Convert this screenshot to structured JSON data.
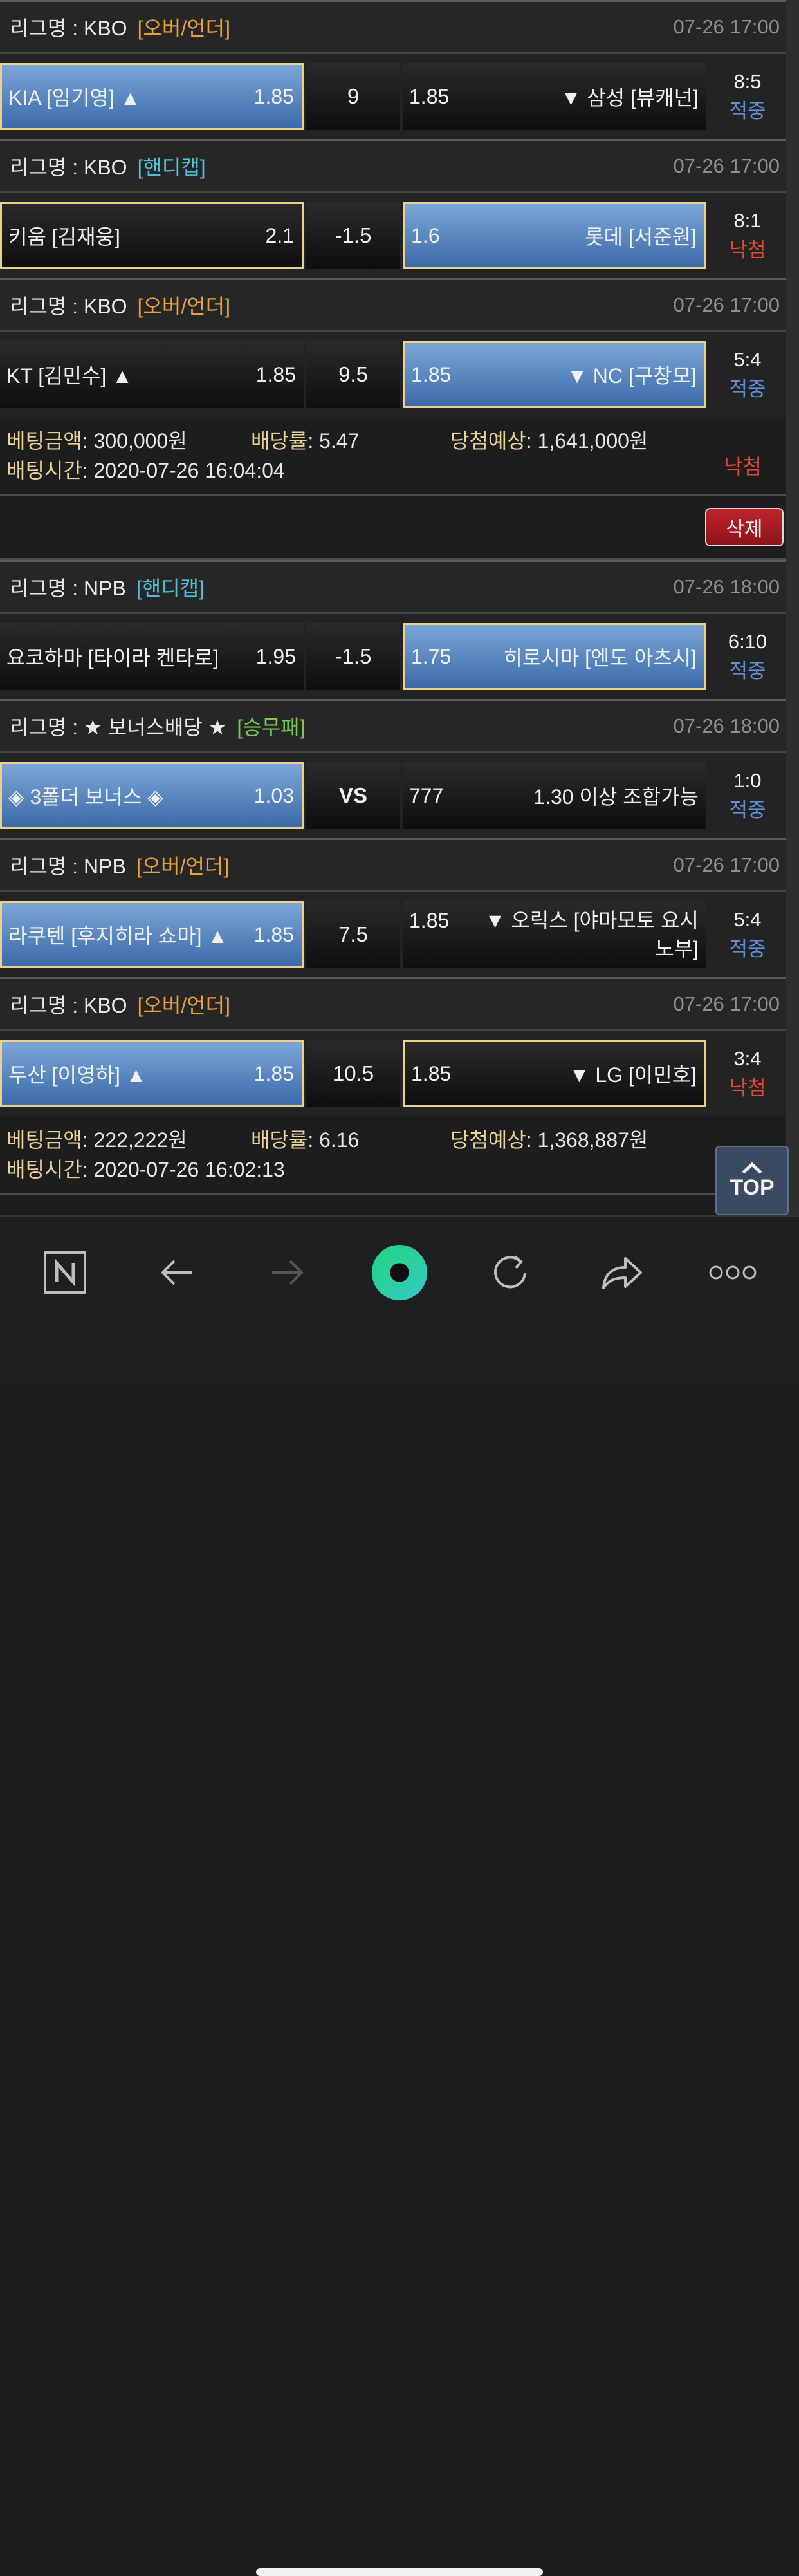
{
  "matches_block1": [
    {
      "league": "리그명 : KBO",
      "type": "[오버/언더]",
      "type_class": "t-ou",
      "time": "07-26 17:00",
      "home": "KIA [임기영] ▲",
      "home_odds": "1.85",
      "handicap": "9",
      "away_odds": "1.85",
      "away": "▼ 삼성 [뷰캐넌]",
      "score": "8:5",
      "status": "적중",
      "selected": "home"
    },
    {
      "league": "리그명 : KBO",
      "type": "[핸디캡]",
      "type_class": "t-hc",
      "time": "07-26 17:00",
      "home": "키움 [김재웅]",
      "home_odds": "2.1",
      "handicap": "-1.5",
      "away_odds": "1.6",
      "away": "롯데 [서준원]",
      "score": "8:1",
      "status": "낙첨",
      "selected": "away_blue_home_outline"
    },
    {
      "league": "리그명 : KBO",
      "type": "[오버/언더]",
      "type_class": "t-ou",
      "time": "07-26 17:00",
      "home": "KT [김민수] ▲",
      "home_odds": "1.85",
      "handicap": "9.5",
      "away_odds": "1.85",
      "away": "▼ NC [구창모]",
      "score": "5:4",
      "status": "적중",
      "selected": "away"
    }
  ],
  "bet1": {
    "amount_label": "베팅금액",
    "amount": ": 300,000원",
    "rate_label": "배당률",
    "rate": ": 5.47",
    "expect_label": "당첨예상",
    "expect": ": 1,641,000원",
    "time_label": "배팅시간",
    "time": " : 2020-07-26 16:04:04",
    "result": "낙첨"
  },
  "delete_label": "삭제",
  "matches_block2": [
    {
      "league": "리그명 : NPB",
      "type": "[핸디캡]",
      "type_class": "t-hc",
      "time": "07-26 18:00",
      "home": "요코하마 [타이라 켄타로]",
      "home_odds": "1.95",
      "handicap": "-1.5",
      "away_odds": "1.75",
      "away": "히로시마 [엔도 아츠시]",
      "score": "6:10",
      "status": "적중",
      "selected": "away"
    },
    {
      "league": "리그명 : ★ 보너스배당 ★",
      "type": "[승무패]",
      "type_class": "t-wdl",
      "time": "07-26 18:00",
      "home": "◈ 3폴더 보너스 ◈",
      "home_odds": "1.03",
      "handicap": "VS",
      "away_odds": "777",
      "away": "1.30 이상 조합가능",
      "score": "1:0",
      "status": "적중",
      "selected": "home"
    },
    {
      "league": "리그명 : NPB",
      "type": "[오버/언더]",
      "type_class": "t-ou",
      "time": "07-26 17:00",
      "home": "라쿠텐 [후지히라 쇼마] ▲",
      "home_odds": "1.85",
      "handicap": "7.5",
      "away_odds": "1.85",
      "away": "▼ 오릭스 [야마모토 요시노부]",
      "score": "5:4",
      "status": "적중",
      "selected": "home",
      "wrap": true
    },
    {
      "league": "리그명 : KBO",
      "type": "[오버/언더]",
      "type_class": "t-ou",
      "time": "07-26 17:00",
      "home": "두산 [이영하] ▲",
      "home_odds": "1.85",
      "handicap": "10.5",
      "away_odds": "1.85",
      "away": "▼ LG [이민호]",
      "score": "3:4",
      "status": "낙첨",
      "selected": "home_blue_away_outline"
    }
  ],
  "bet2": {
    "amount_label": "베팅금액",
    "amount": ": 222,222원",
    "rate_label": "배당률",
    "rate": ": 6.16",
    "expect_label": "당첨예상",
    "expect": ": 1,368,887원",
    "time_label": "배팅시간",
    "time": " : 2020-07-26 16:02:13"
  },
  "top_label": "TOP",
  "toolbar_icons": [
    "naver-n-icon",
    "back-arrow-icon",
    "forward-arrow-icon",
    "green-circle-icon",
    "refresh-icon",
    "share-icon",
    "more-dots-icon"
  ]
}
